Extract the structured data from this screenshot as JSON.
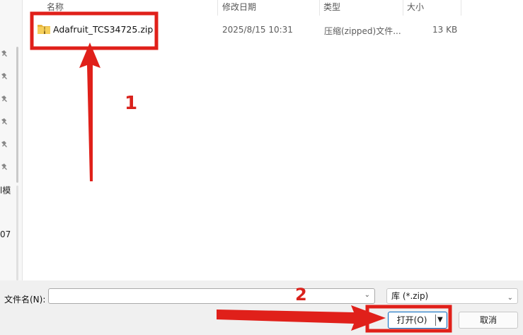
{
  "left_pane": {
    "edge_text_1": "l模",
    "edge_text_2": "07"
  },
  "columns": {
    "name": "名称",
    "modified": "修改日期",
    "type": "类型",
    "size": "大小"
  },
  "files": [
    {
      "name": "Adafruit_TCS34725.zip",
      "modified": "2025/8/15 10:31",
      "type": "压缩(zipped)文件...",
      "size": "13 KB",
      "icon": "zip-folder-icon"
    }
  ],
  "bottom": {
    "filename_label": "文件名(N):",
    "filename_value": "",
    "filter": "库 (*.zip)",
    "open_label": "打开(O)",
    "cancel_label": "取消"
  },
  "annotations": {
    "step1": "1",
    "step2": "2",
    "color": "#e0201a"
  }
}
